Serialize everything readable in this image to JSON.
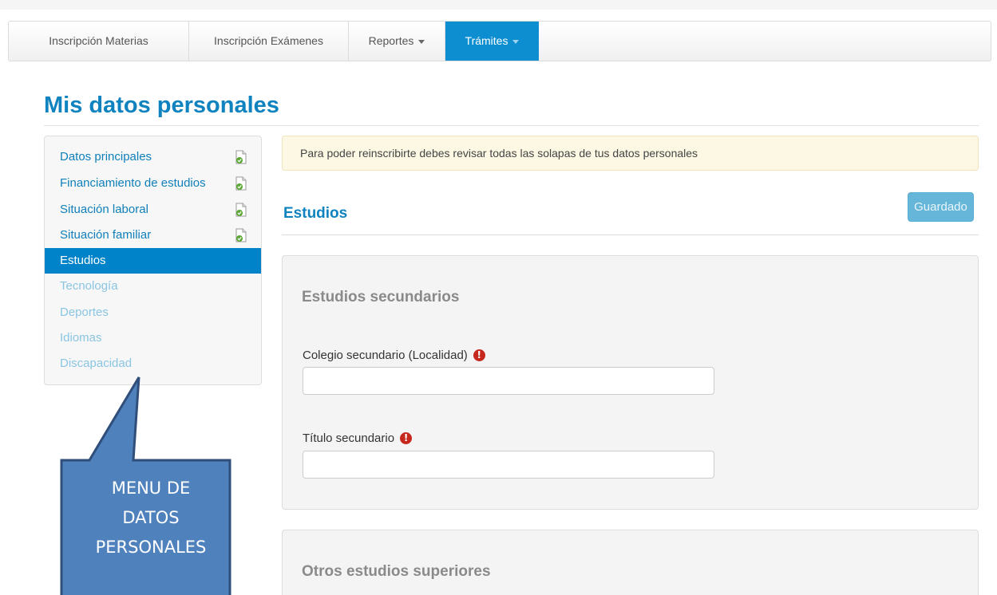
{
  "navbar": {
    "items": [
      {
        "label": "Inscripción Materias",
        "has_dropdown": false,
        "active": false
      },
      {
        "label": "Inscripción Exámenes",
        "has_dropdown": false,
        "active": false
      },
      {
        "label": "Reportes",
        "has_dropdown": true,
        "active": false
      },
      {
        "label": "Trámites",
        "has_dropdown": true,
        "active": true
      }
    ]
  },
  "page": {
    "title": "Mis datos personales"
  },
  "side_menu": {
    "items": [
      {
        "label": "Datos principales",
        "state": "completed",
        "icon": "document-check-icon"
      },
      {
        "label": "Financiamiento de estudios",
        "state": "completed",
        "icon": "document-check-icon"
      },
      {
        "label": "Situación laboral",
        "state": "completed",
        "icon": "document-check-icon"
      },
      {
        "label": "Situación familiar",
        "state": "completed",
        "icon": "document-check-icon"
      },
      {
        "label": "Estudios",
        "state": "active"
      },
      {
        "label": "Tecnología",
        "state": "disabled"
      },
      {
        "label": "Deportes",
        "state": "disabled"
      },
      {
        "label": "Idiomas",
        "state": "disabled"
      },
      {
        "label": "Discapacidad",
        "state": "disabled"
      }
    ]
  },
  "alert": {
    "text": "Para poder reinscribirte debes revisar todas las solapas de tus datos personales"
  },
  "section": {
    "title": "Estudios",
    "save_label": "Guardado"
  },
  "panels": {
    "secundarios": {
      "title": "Estudios secundarios",
      "fields": {
        "colegio": {
          "label": "Colegio secundario (Localidad)",
          "value": "",
          "required_icon": "exclamation-circle-icon"
        },
        "titulo": {
          "label": "Título secundario",
          "value": "",
          "required_icon": "exclamation-circle-icon"
        }
      }
    },
    "superiores": {
      "title": "Otros estudios superiores"
    }
  },
  "callout": {
    "lines": [
      "MENU DE",
      "DATOS",
      "PERSONALES"
    ]
  },
  "colors": {
    "brand_blue": "#0f83bf",
    "active_blue": "#0083c8",
    "disabled_link": "#8ac5e3",
    "alert_bg": "#fcf8e3",
    "callout_fill": "#4f81bd",
    "callout_stroke": "#2f4e7a",
    "required_red": "#c7281e"
  }
}
